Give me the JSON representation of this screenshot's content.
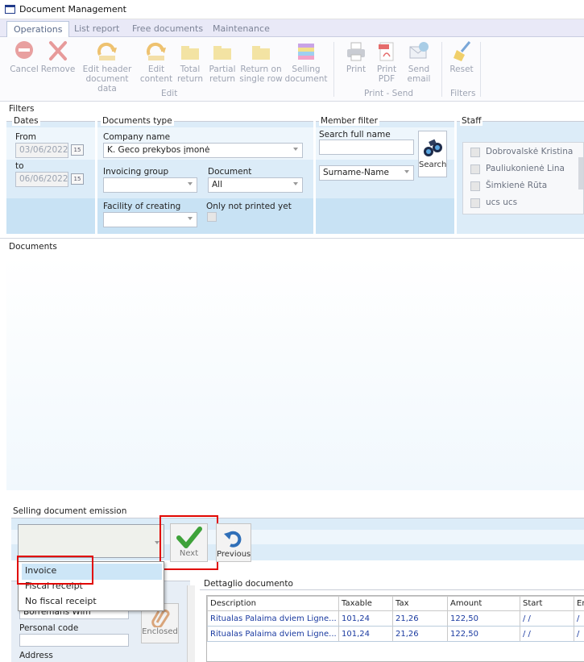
{
  "window": {
    "title": "Document Management"
  },
  "tabs": [
    {
      "label": "Operations",
      "active": true
    },
    {
      "label": "List report"
    },
    {
      "label": "Free documents"
    },
    {
      "label": "Maintenance"
    }
  ],
  "ribbon": {
    "buttons": {
      "cancel": "Cancel",
      "remove": "Remove",
      "edit_header_1": "Edit header",
      "edit_header_2": "document data",
      "edit_content_1": "Edit",
      "edit_content_2": "content",
      "total_return_1": "Total",
      "total_return_2": "return",
      "partial_return_1": "Partial",
      "partial_return_2": "return",
      "return_single_1": "Return on",
      "return_single_2": "single row",
      "selling_doc_1": "Selling",
      "selling_doc_2": "document",
      "print": "Print",
      "print_pdf_1": "Print",
      "print_pdf_2": "PDF",
      "send_email_1": "Send",
      "send_email_2": "email",
      "reset": "Reset"
    },
    "groups": {
      "edit": "Edit",
      "print_send": "Print - Send",
      "filters": "Filters"
    }
  },
  "filters": {
    "label": "Filters",
    "dates": {
      "label": "Dates",
      "from_label": "From",
      "from_value": "03/06/2022",
      "to_label": "to",
      "to_value": "06/06/2022",
      "cal": "15"
    },
    "doc_type": {
      "label": "Documents type",
      "company_label": "Company name",
      "company_value": "K. Geco prekybos įmonė",
      "invoicing_group_label": "Invoicing group",
      "document_label": "Document",
      "document_value": "All",
      "facility_label": "Facility of creating",
      "only_not_printed_label": "Only not printed yet"
    },
    "member": {
      "label": "Member filter",
      "search_full_name_label": "Search full name",
      "order_value": "Surname-Name",
      "search_button": "Search"
    },
    "staff": {
      "label": "Staff",
      "items": [
        "Dobrovalskė Kristina",
        "Pauliukonienė Lina",
        "Šimkienė Rūta",
        "ucs ucs"
      ]
    }
  },
  "documents": {
    "label": "Documents"
  },
  "emission": {
    "label": "Selling document emission",
    "next": "Next",
    "previous": "Previous",
    "options": [
      "Invoice",
      "Fiscal receipt",
      "No fiscal receipt"
    ],
    "highlighted": "Invoice"
  },
  "customer": {
    "name_value": "Borremans Wim",
    "personal_code_label": "Personal code",
    "address_label": "Address",
    "enclosed": "Enclosed"
  },
  "detail": {
    "label": "Dettaglio documento",
    "columns": [
      "Description",
      "Taxable",
      "Tax",
      "Amount",
      "Start",
      "En"
    ],
    "rows": [
      [
        "Ritualas Palaima dviem Ligne...",
        "101,24",
        "21,26",
        "122,50",
        "/  /",
        "/"
      ],
      [
        "Ritualas Palaima dviem Ligne...",
        "101,24",
        "21,26",
        "122,50",
        "/  /",
        "/"
      ]
    ]
  },
  "colors": {
    "accent_blue": "#1a3aa0",
    "highlight_red": "#e10600",
    "panel_blue": "#dcecf8"
  }
}
